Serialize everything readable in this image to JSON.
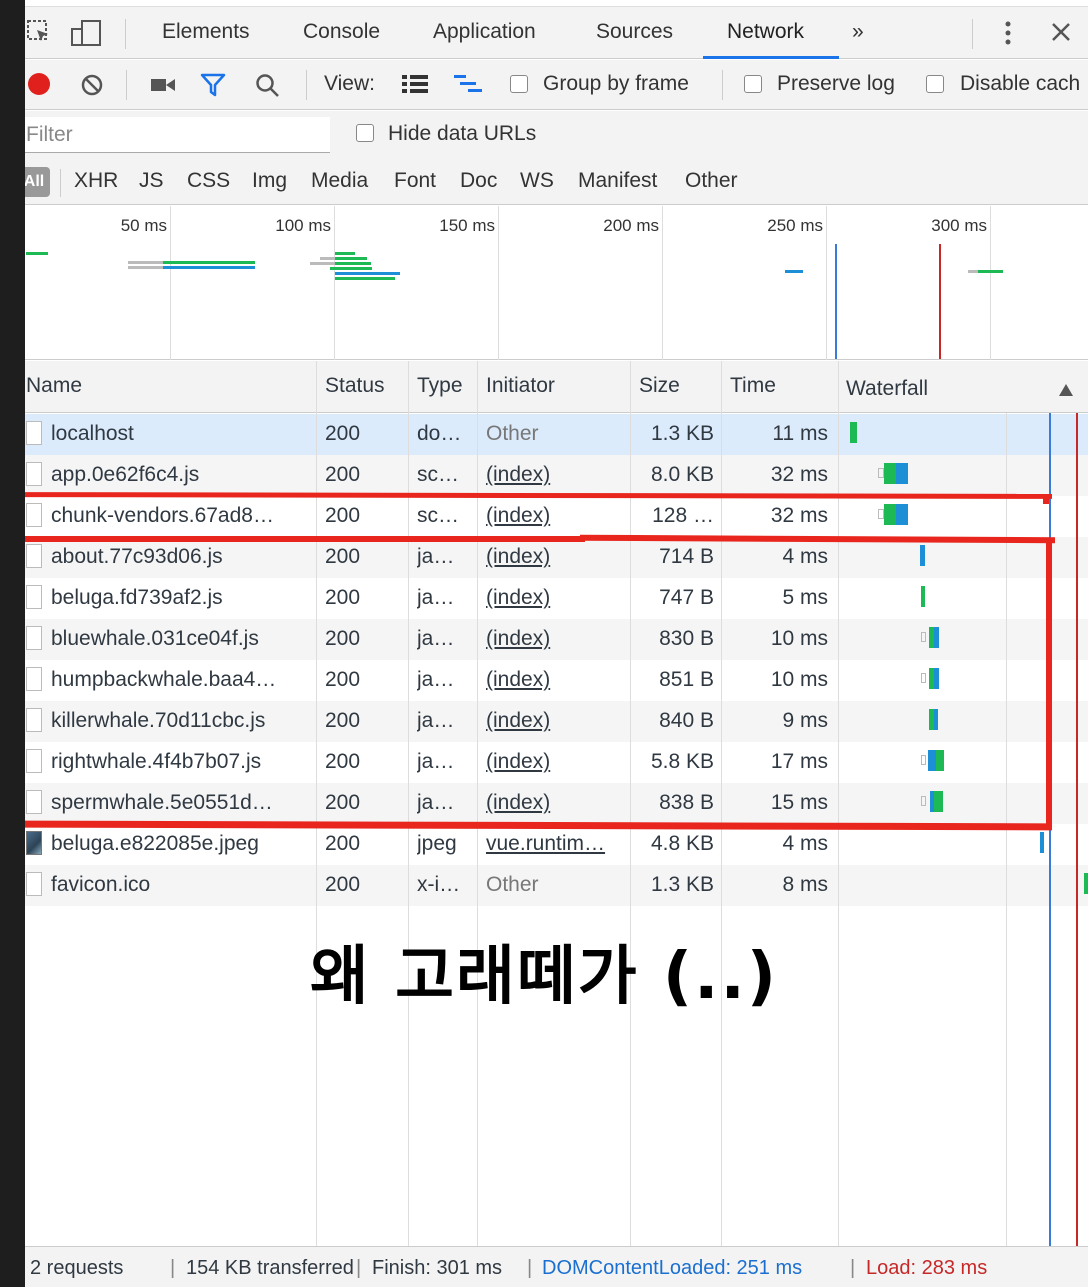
{
  "tabs": [
    "Elements",
    "Console",
    "Application",
    "Sources",
    "Network"
  ],
  "more_tabs": "»",
  "toolbar": {
    "view_label": "View:",
    "group_by_frame": "Group by frame",
    "preserve_log": "Preserve log",
    "disable_cache": "Disable cach"
  },
  "filter": {
    "placeholder": "Filter",
    "hide_data_urls": "Hide data URLs"
  },
  "type_filters": [
    "All",
    "XHR",
    "JS",
    "CSS",
    "Img",
    "Media",
    "Font",
    "Doc",
    "WS",
    "Manifest",
    "Other"
  ],
  "overview_ticks": [
    "50 ms",
    "100 ms",
    "150 ms",
    "200 ms",
    "250 ms",
    "300 ms"
  ],
  "columns": [
    "Name",
    "Status",
    "Type",
    "Initiator",
    "Size",
    "Time",
    "Waterfall"
  ],
  "rows": [
    {
      "name": "localhost",
      "status": "200",
      "type": "do…",
      "initiator": "Other",
      "size": "1.3 KB",
      "time": "11 ms"
    },
    {
      "name": "app.0e62f6c4.js",
      "status": "200",
      "type": "sc…",
      "initiator": "(index)",
      "size": "8.0 KB",
      "time": "32 ms"
    },
    {
      "name": "chunk-vendors.67ad8…",
      "status": "200",
      "type": "sc…",
      "initiator": "(index)",
      "size": "128 …",
      "time": "32 ms"
    },
    {
      "name": "about.77c93d06.js",
      "status": "200",
      "type": "ja…",
      "initiator": "(index)",
      "size": "714 B",
      "time": "4 ms"
    },
    {
      "name": "beluga.fd739af2.js",
      "status": "200",
      "type": "ja…",
      "initiator": "(index)",
      "size": "747 B",
      "time": "5 ms"
    },
    {
      "name": "bluewhale.031ce04f.js",
      "status": "200",
      "type": "ja…",
      "initiator": "(index)",
      "size": "830 B",
      "time": "10 ms"
    },
    {
      "name": "humpbackwhale.baa4…",
      "status": "200",
      "type": "ja…",
      "initiator": "(index)",
      "size": "851 B",
      "time": "10 ms"
    },
    {
      "name": "killerwhale.70d11cbc.js",
      "status": "200",
      "type": "ja…",
      "initiator": "(index)",
      "size": "840 B",
      "time": "9 ms"
    },
    {
      "name": "rightwhale.4f4b7b07.js",
      "status": "200",
      "type": "ja…",
      "initiator": "(index)",
      "size": "5.8 KB",
      "time": "17 ms"
    },
    {
      "name": "spermwhale.5e0551d…",
      "status": "200",
      "type": "ja…",
      "initiator": "(index)",
      "size": "838 B",
      "time": "15 ms"
    },
    {
      "name": "beluga.e822085e.jpeg",
      "status": "200",
      "type": "jpeg",
      "initiator": "vue.runtim…",
      "size": "4.8 KB",
      "time": "4 ms"
    },
    {
      "name": "favicon.ico",
      "status": "200",
      "type": "x-i…",
      "initiator": "Other",
      "size": "1.3 KB",
      "time": "8 ms"
    }
  ],
  "annotation": "왜 고래떼가 (..)",
  "status": {
    "requests": "2 requests",
    "transferred": "154 KB transferred",
    "finish": "Finish: 301 ms",
    "dcl": "DOMContentLoaded: 251 ms",
    "load": "Load: 283 ms"
  },
  "colors": {
    "accent": "#1a73e8",
    "dcl": "#3a7bd5",
    "load": "#c62828",
    "bar_green": "#1db954",
    "bar_blue": "#1c8fd6",
    "record_red": "#e0201c",
    "annotation_red": "#e8261d"
  }
}
